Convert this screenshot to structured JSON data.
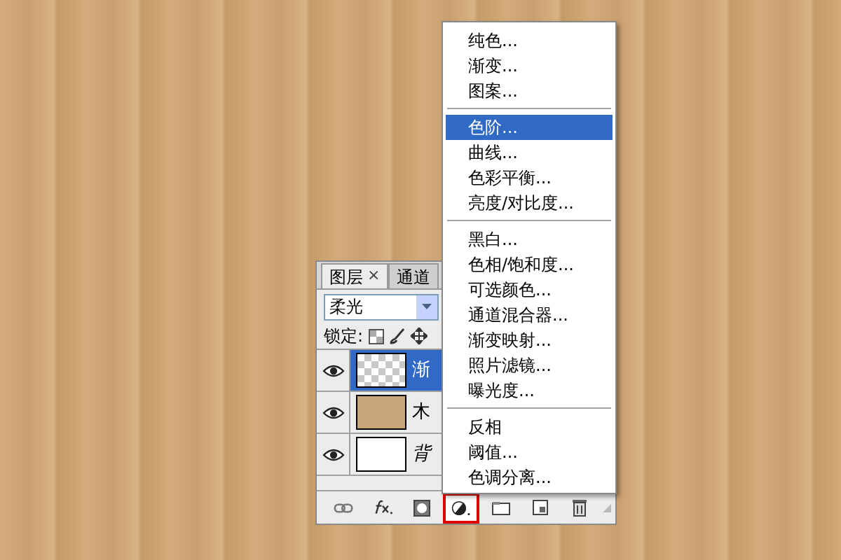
{
  "layers_panel": {
    "tabs": [
      {
        "label": "图层",
        "close": "×",
        "selected": true
      },
      {
        "label": "通道",
        "selected": false
      }
    ],
    "blend_mode": "柔光",
    "lock_label": "锁定:",
    "layers": [
      {
        "name": "渐",
        "kind": "transparent",
        "selected": true,
        "visible": true,
        "italic": false
      },
      {
        "name": "木",
        "kind": "wood",
        "selected": false,
        "visible": true,
        "italic": false
      },
      {
        "name": "背",
        "kind": "white",
        "selected": false,
        "visible": true,
        "italic": true
      }
    ],
    "toolbar": [
      {
        "kind": "link",
        "highlighted": false
      },
      {
        "kind": "fx",
        "highlighted": false
      },
      {
        "kind": "mask",
        "highlighted": false
      },
      {
        "kind": "adjustment",
        "highlighted": true
      },
      {
        "kind": "folder",
        "highlighted": false
      },
      {
        "kind": "new",
        "highlighted": false
      },
      {
        "kind": "trash",
        "highlighted": false
      }
    ]
  },
  "adjustment_menu": [
    {
      "kind": "item",
      "label": "纯色...",
      "selected": false
    },
    {
      "kind": "item",
      "label": "渐变...",
      "selected": false
    },
    {
      "kind": "item",
      "label": "图案...",
      "selected": false
    },
    {
      "kind": "separator"
    },
    {
      "kind": "item",
      "label": "色阶...",
      "selected": true
    },
    {
      "kind": "item",
      "label": "曲线...",
      "selected": false
    },
    {
      "kind": "item",
      "label": "色彩平衡...",
      "selected": false
    },
    {
      "kind": "item",
      "label": "亮度/对比度...",
      "selected": false
    },
    {
      "kind": "separator"
    },
    {
      "kind": "item",
      "label": "黑白...",
      "selected": false
    },
    {
      "kind": "item",
      "label": "色相/饱和度...",
      "selected": false
    },
    {
      "kind": "item",
      "label": "可选颜色...",
      "selected": false
    },
    {
      "kind": "item",
      "label": "通道混合器...",
      "selected": false
    },
    {
      "kind": "item",
      "label": "渐变映射...",
      "selected": false
    },
    {
      "kind": "item",
      "label": "照片滤镜...",
      "selected": false
    },
    {
      "kind": "item",
      "label": "曝光度...",
      "selected": false
    },
    {
      "kind": "separator"
    },
    {
      "kind": "item",
      "label": "反相",
      "selected": false
    },
    {
      "kind": "item",
      "label": "阈值...",
      "selected": false
    },
    {
      "kind": "item",
      "label": "色调分离...",
      "selected": false
    }
  ]
}
